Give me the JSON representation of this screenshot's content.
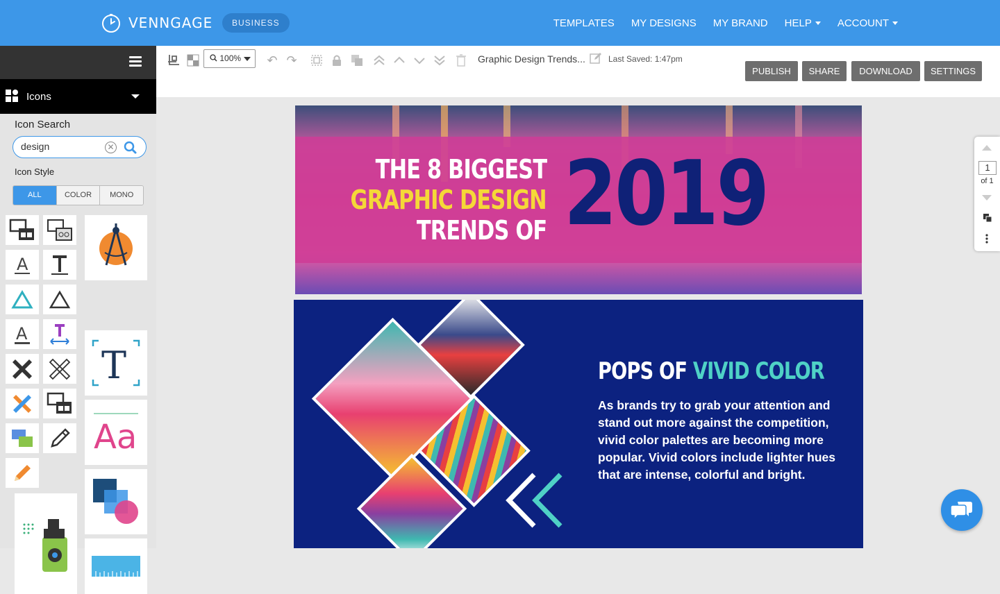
{
  "topnav": {
    "brand": "VENNGAGE",
    "plan": "BUSINESS",
    "links": {
      "templates": "TEMPLATES",
      "my_designs": "MY DESIGNS",
      "my_brand": "MY BRAND",
      "help": "HELP",
      "account": "ACCOUNT"
    }
  },
  "sidebar": {
    "category": "Icons",
    "search_label": "Icon Search",
    "search_value": "design",
    "style_label": "Icon Style",
    "styles": {
      "all": "ALL",
      "color": "COLOR",
      "mono": "MONO"
    },
    "active_style": "ALL"
  },
  "toolbar": {
    "zoom": "100%",
    "doc_title": "Graphic Design Trends...",
    "last_saved": "Last Saved: 1:47pm",
    "publish": "PUBLISH",
    "share": "SHARE",
    "download": "DOWNLOAD",
    "settings": "SETTINGS"
  },
  "canvas": {
    "headline_1": "THE 8 BIGGEST",
    "headline_2": "GRAPHIC DESIGN",
    "headline_3": "TRENDS OF",
    "year": "2019",
    "section_title_a": "POPS OF ",
    "section_title_b": "VIVID COLOR",
    "section_body": "As brands try to grab your attention and stand out more against the competition, vivid color palettes are becoming more popular. Vivid colors include lighter hues that are intense, colorful and bright."
  },
  "pager": {
    "current": "1",
    "total": "of 1"
  },
  "colors": {
    "nav_blue": "#3d97e8",
    "panel_navy": "#0c2280",
    "accent_teal": "#4fd1c6",
    "accent_yellow": "#f5d838",
    "banner_pink": "#e0458c"
  }
}
